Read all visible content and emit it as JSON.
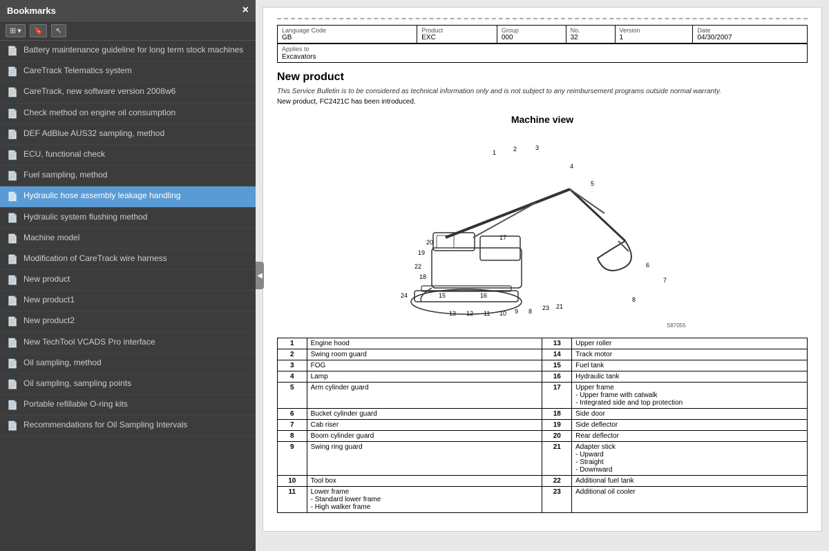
{
  "sidebar": {
    "title": "Bookmarks",
    "close_label": "×",
    "toolbar": {
      "layout_icon": "⊞",
      "bookmark_icon": "🔖",
      "cursor_icon": "↖"
    },
    "items": [
      {
        "id": 1,
        "label": "Battery maintenance guideline for long term stock machines",
        "active": false
      },
      {
        "id": 2,
        "label": "CareTrack Telematics system",
        "active": false
      },
      {
        "id": 3,
        "label": "CareTrack, new software version 2008w6",
        "active": false
      },
      {
        "id": 4,
        "label": "Check method on engine oil consumption",
        "active": false
      },
      {
        "id": 5,
        "label": "DEF AdBlue AUS32 sampling, method",
        "active": false
      },
      {
        "id": 6,
        "label": "ECU, functional check",
        "active": false
      },
      {
        "id": 7,
        "label": "Fuel sampling, method",
        "active": false
      },
      {
        "id": 8,
        "label": "Hydraulic hose assembly leakage handling",
        "active": true
      },
      {
        "id": 9,
        "label": "Hydraulic system flushing method",
        "active": false
      },
      {
        "id": 10,
        "label": "Machine model",
        "active": false
      },
      {
        "id": 11,
        "label": "Modification of CareTrack wire harness",
        "active": false
      },
      {
        "id": 12,
        "label": "New product",
        "active": false
      },
      {
        "id": 13,
        "label": "New product1",
        "active": false
      },
      {
        "id": 14,
        "label": "New product2",
        "active": false
      },
      {
        "id": 15,
        "label": "New TechTool VCADS Pro interface",
        "active": false
      },
      {
        "id": 16,
        "label": "Oil sampling, method",
        "active": false
      },
      {
        "id": 17,
        "label": "Oil sampling, sampling points",
        "active": false
      },
      {
        "id": 18,
        "label": "Portable refillable O-ring kits",
        "active": false
      },
      {
        "id": 19,
        "label": "Recommendations for Oil Sampling Intervals",
        "active": false
      }
    ]
  },
  "document": {
    "header": {
      "language_code_label": "Language Code",
      "language_code_value": "GB",
      "product_label": "Product",
      "product_value": "EXC",
      "group_label": "Group",
      "group_value": "000",
      "no_label": "No.",
      "no_value": "32",
      "version_label": "Version",
      "version_value": "1",
      "date_label": "Date",
      "date_value": "04/30/2007",
      "applies_label": "Applies to",
      "applies_value": "Excavators"
    },
    "title": "New product",
    "description": "This Service Bulletin is to be considered as technical information only and is not subject to any reimbursement programs outside normal warranty.",
    "note": "New product, FC2421C has been introduced.",
    "machine_view_title": "Machine view",
    "parts": [
      {
        "num": "1",
        "desc": "Engine hood",
        "num2": "13",
        "desc2": "Upper roller"
      },
      {
        "num": "2",
        "desc": "Swing room guard",
        "num2": "14",
        "desc2": "Track motor"
      },
      {
        "num": "3",
        "desc": "FOG",
        "num2": "15",
        "desc2": "Fuel tank"
      },
      {
        "num": "4",
        "desc": "Lamp",
        "num2": "16",
        "desc2": "Hydraulic tank"
      },
      {
        "num": "5",
        "desc": "Arm cylinder guard",
        "num2": "17",
        "desc2": "Upper frame\n- Upper frame with catwalk\n- Integrated side and top protection"
      },
      {
        "num": "6",
        "desc": "Bucket cylinder guard",
        "num2": "18",
        "desc2": "Side door"
      },
      {
        "num": "7",
        "desc": "Cab riser",
        "num2": "19",
        "desc2": "Side deflector"
      },
      {
        "num": "8",
        "desc": "Boom cylinder guard",
        "num2": "20",
        "desc2": "Rear deflector"
      },
      {
        "num": "9",
        "desc": "Swing ring guard",
        "num2": "21",
        "desc2": "Adapter stick\n- Upward\n- Straight\n- Downward"
      },
      {
        "num": "10",
        "desc": "Tool box",
        "num2": "22",
        "desc2": "Additional fuel tank"
      },
      {
        "num": "11",
        "desc": "Lower frame\n- Standard lower frame\n- High walker frame",
        "num2": "23",
        "desc2": "Additional oil cooler"
      }
    ]
  }
}
